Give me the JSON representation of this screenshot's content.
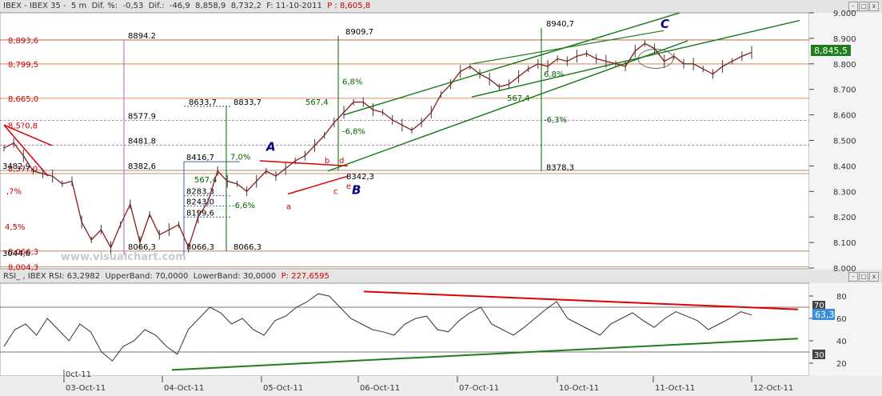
{
  "window": {
    "price_header": {
      "symbol": "IBEX - IBEX 35 -",
      "interval": "5 m",
      "dif_pct_label": "Dif. %:",
      "dif_pct": "-0,53",
      "dif_label": "Dif.:",
      "dif": "-46,9",
      "max": "8,858,9",
      "min": "8,732,2",
      "date_label": "F:",
      "date": "11-10-2011",
      "p_label": "P :",
      "p_value": "8,605,8"
    },
    "rsi_header": {
      "name": "RSI_ , IBEX RSI:",
      "rsi": "63,2982",
      "upper_label": "UpperBand:",
      "upper": "70,0000",
      "lower_label": "LowerBand:",
      "lower": "30,0000",
      "p_label": "P:",
      "p_value": "227,6595"
    },
    "buttons": [
      "-",
      "□",
      "x"
    ],
    "watermark": "www.visualchart.com",
    "last_price_badge": "8,845,5",
    "rsi_value_badge": "63,3",
    "rsi_band_badges": [
      "70",
      "30"
    ],
    "rsi_axis_ticks": [
      "80",
      "60",
      "40",
      "20"
    ],
    "x_first_label": "0ct-11",
    "x_ticks": [
      "03-Oct-11",
      "04-Oct-11",
      "05-Oct-11",
      "06-Oct-11",
      "07-Oct-11",
      "10-Oct-11",
      "11-Oct-11",
      "12-Oct-11"
    ]
  },
  "chart_data": [
    {
      "type": "line",
      "title": "IBEX - IBEX 35 - 5 m",
      "xlabel": "",
      "ylabel": "",
      "x": [
        "03-Oct-11",
        "04-Oct-11",
        "05-Oct-11",
        "06-Oct-11",
        "07-Oct-11",
        "10-Oct-11",
        "11-Oct-11",
        "12-Oct-11"
      ],
      "ylim": [
        8000,
        9000
      ],
      "y_ticks": [
        "9.000",
        "8.900",
        "8.800",
        "8.700",
        "8.600",
        "8.500",
        "8.400",
        "8.300",
        "8.200",
        "8.100",
        "8.000"
      ],
      "series": [
        {
          "values": [
            8470,
            8490,
            8440,
            8380,
            8370,
            8360,
            8330,
            8340,
            8180,
            8110,
            8150,
            8080,
            8170,
            8250,
            8100,
            8210,
            8130,
            8150,
            8170,
            8080,
            8200,
            8260,
            8380,
            8340,
            8330,
            8300,
            8340,
            8380,
            8360,
            8390,
            8420,
            8440,
            8480,
            8520,
            8570,
            8610,
            8650,
            8650,
            8620,
            8610,
            8580,
            8560,
            8540,
            8570,
            8610,
            8680,
            8720,
            8770,
            8790,
            8760,
            8740,
            8710,
            8720,
            8750,
            8780,
            8800,
            8790,
            8820,
            8810,
            8830,
            8840,
            8820,
            8810,
            8800,
            8790,
            8850,
            8880,
            8860,
            8810,
            8830,
            8800,
            8800,
            8780,
            8760,
            8790,
            8810,
            8830,
            8845
          ]
        }
      ],
      "levels": [
        "8,893,6",
        "8,799,5",
        "8,665,0",
        "8,5?0,8",
        "8,37?,0",
        "8,066,3",
        "8,004,3"
      ],
      "level_labels": [
        "8894.2",
        "8577.9",
        "8481.8",
        "8382,6",
        "8066,3",
        "8633,7",
        "8416,7",
        "8283,3",
        "8243,0",
        "8199,6",
        "8066,3",
        "8909,7",
        "8940,7",
        "8378,3",
        "8342,3",
        "3482,9",
        "3044,6",
        "8833,7",
        "8066,3"
      ],
      "annotations": [
        "A",
        "B",
        "C",
        "a",
        "b",
        "c",
        "d",
        "e",
        "6,8%",
        "567,4",
        "-6,8%",
        "7,0%",
        "567,4",
        "-6,6%",
        "6,8%",
        "567,4",
        "-6,3%",
        ",7%",
        "4,5%"
      ]
    },
    {
      "type": "line",
      "title": "RSI_ , IBEX RSI",
      "ylim": [
        10,
        90
      ],
      "upper_band": 70,
      "lower_band": 30,
      "series": [
        {
          "values": [
            35,
            50,
            55,
            45,
            60,
            50,
            40,
            55,
            48,
            30,
            22,
            35,
            40,
            50,
            45,
            35,
            28,
            50,
            60,
            70,
            65,
            55,
            60,
            50,
            45,
            58,
            62,
            70,
            75,
            82,
            80,
            70,
            60,
            55,
            50,
            48,
            45,
            55,
            60,
            62,
            50,
            48,
            58,
            65,
            70,
            55,
            50,
            45,
            52,
            60,
            68,
            75,
            60,
            55,
            50,
            45,
            55,
            60,
            65,
            58,
            52,
            60,
            66,
            62,
            58,
            50,
            55,
            60,
            66,
            63
          ]
        }
      ]
    }
  ]
}
